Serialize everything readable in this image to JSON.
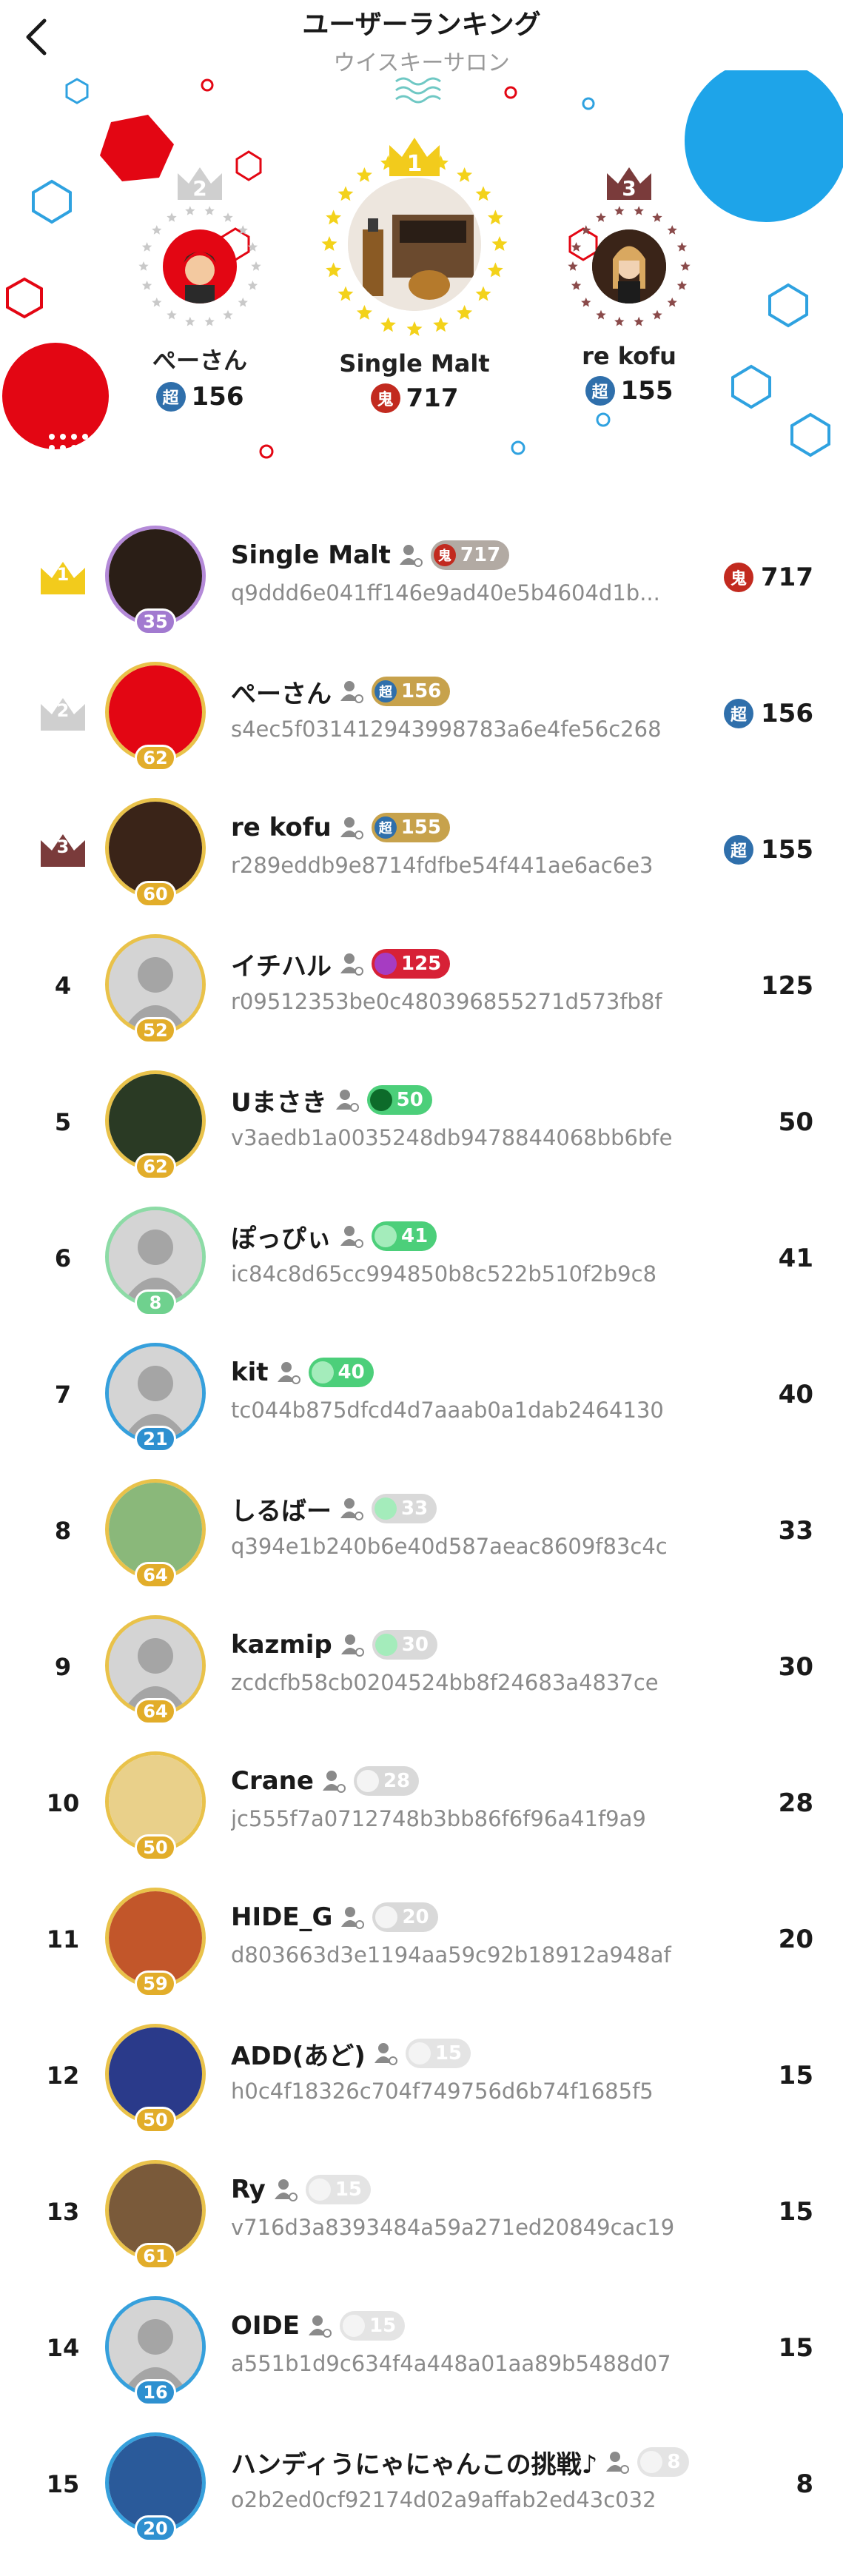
{
  "header": {
    "title": "ユーザーランキング",
    "subtitle": "ウイスキーサロン"
  },
  "colors": {
    "accent_red": "#e30613",
    "accent_blue": "#1ea4e9",
    "gold": "#e9c24a",
    "badge_blue": "#2f6fab",
    "badge_red": "#c22a1f"
  },
  "badges": {
    "super": "超",
    "oni": "鬼"
  },
  "podium": {
    "second": {
      "rank": "2",
      "name": "ぺーさん",
      "score": "156",
      "badge": "超"
    },
    "first": {
      "rank": "1",
      "name": "Single Malt",
      "score": "717",
      "badge": "鬼"
    },
    "third": {
      "rank": "3",
      "name": "re kofu",
      "score": "155",
      "badge": "超"
    }
  },
  "rows": [
    {
      "rank": "1",
      "name": "Single Malt",
      "chip": "717",
      "chip_badge": "鬼",
      "id": "q9ddd6e041ff146e9ad40e5b4604d1b...",
      "score": "717",
      "score_badge": "鬼",
      "level": "35"
    },
    {
      "rank": "2",
      "name": "ぺーさん",
      "chip": "156",
      "chip_badge": "超",
      "id": "s4ec5f031412943998783a6e4fe56c268",
      "score": "156",
      "score_badge": "超",
      "level": "62"
    },
    {
      "rank": "3",
      "name": "re kofu",
      "chip": "155",
      "chip_badge": "超",
      "id": "r289eddb9e8714fdfbe54f441ae6ac6e3",
      "score": "155",
      "score_badge": "超",
      "level": "60"
    },
    {
      "rank": "4",
      "name": "イチハル",
      "chip": "125",
      "id": "r09512353be0c480396855271d573fb8f",
      "score": "125",
      "level": "52"
    },
    {
      "rank": "5",
      "name": "Uまさき",
      "chip": "50",
      "id": "v3aedb1a0035248db9478844068bb6bfe",
      "score": "50",
      "level": "62"
    },
    {
      "rank": "6",
      "name": "ぽっぴぃ",
      "chip": "41",
      "id": "ic84c8d65cc994850b8c522b510f2b9c8",
      "score": "41",
      "level": "8"
    },
    {
      "rank": "7",
      "name": "kit",
      "chip": "40",
      "id": "tc044b875dfcd4d7aaab0a1dab2464130",
      "score": "40",
      "level": "21"
    },
    {
      "rank": "8",
      "name": "しるばー",
      "chip": "33",
      "id": "q394e1b240b6e40d587aeac8609f83c4c",
      "score": "33",
      "level": "64"
    },
    {
      "rank": "9",
      "name": "kazmip",
      "chip": "30",
      "id": "zcdcfb58cb0204524bb8f24683a4837ce",
      "score": "30",
      "level": "64"
    },
    {
      "rank": "10",
      "name": "Crane",
      "chip": "28",
      "id": "jc555f7a0712748b3bb86f6f96a41f9a9",
      "score": "28",
      "level": "50"
    },
    {
      "rank": "11",
      "name": "HIDE_G",
      "chip": "20",
      "id": "d803663d3e1194aa59c92b18912a948af",
      "score": "20",
      "level": "59"
    },
    {
      "rank": "12",
      "name": "ADD(あど)",
      "chip": "15",
      "id": "h0c4f18326c704f749756d6b74f1685f5",
      "score": "15",
      "level": "50"
    },
    {
      "rank": "13",
      "name": "Ry",
      "chip": "15",
      "id": "v716d3a8393484a59a271ed20849cac19",
      "score": "15",
      "level": "61"
    },
    {
      "rank": "14",
      "name": "OIDE",
      "chip": "15",
      "id": "a551b1d9c634f4a448a01aa89b5488d07",
      "score": "15",
      "level": "16"
    },
    {
      "rank": "15",
      "name": "ハンディうにゃにゃんこの挑戦♪",
      "chip": "8",
      "id": "o2b2ed0cf92174d02a9affab2ed43c032",
      "score": "8",
      "level": "20"
    }
  ]
}
